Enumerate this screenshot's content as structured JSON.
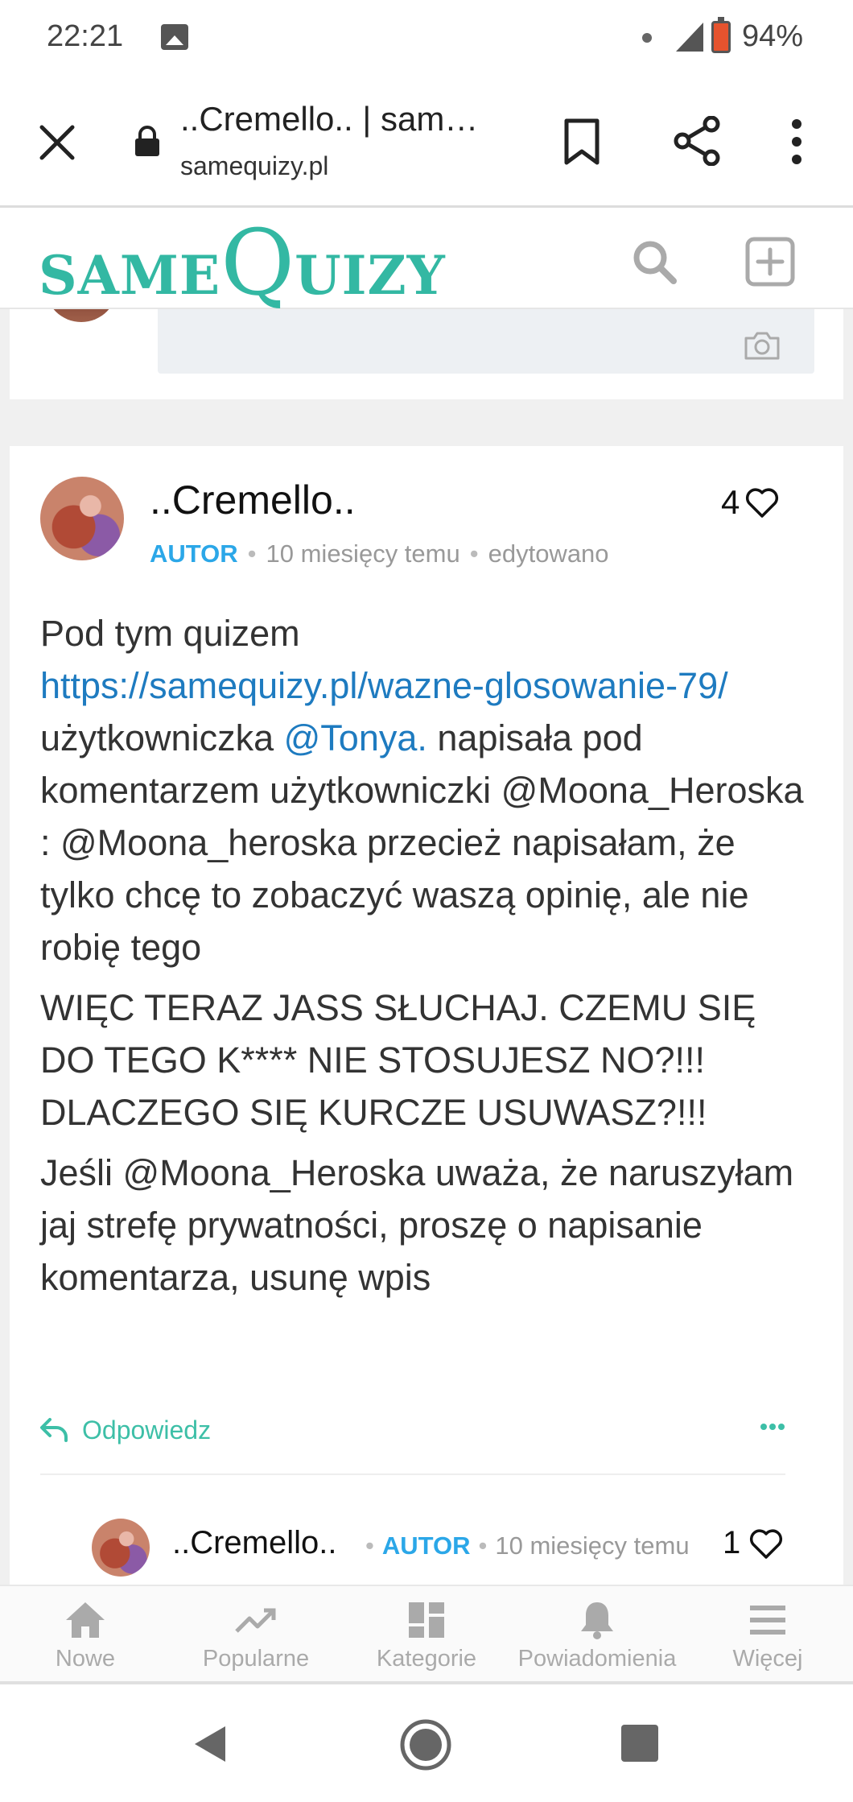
{
  "status_bar": {
    "time": "22:21",
    "battery_percent": "94%"
  },
  "browser": {
    "tab_title": "..Cremello.. | sam…",
    "url": "samequizy.pl"
  },
  "site": {
    "logo_part1": "SAME",
    "logo_q": "Q",
    "logo_part2": "UIZY",
    "brand_color": "#33b8a3"
  },
  "comment": {
    "author": "..Cremello..",
    "badge": "AUTOR",
    "time_ago": "10 miesięcy temu",
    "edited": "edytowano",
    "likes": "4",
    "paragraph1_before_link": "Pod tym quizem",
    "link": "https://samequizy.pl/wazne-glosowanie-79/",
    "paragraph1_before_mention": "użytkowniczka",
    "mention": "@Tonya.",
    "paragraph1_rest": "napisała pod komentarzem użytkowniczki @Moona_Heroska : @Moona_heroska przecież napisałam, że tylko chcę to zobaczyć waszą opinię, ale nie robię tego",
    "paragraph2": "WIĘC TERAZ JASS SŁUCHAJ. CZEMU SIĘ DO TEGO K**** NIE STOSUJESZ NO?!!! DLACZEGO SIĘ KURCZE USUWASZ?!!!",
    "paragraph3": "Jeśli @Moona_Heroska uważa, że naruszyłam jaj strefę prywatności, proszę o napisanie komentarza, usunę wpis",
    "reply_label": "Odpowiedz"
  },
  "sub_comment": {
    "author": "..Cremello..",
    "badge": "AUTOR",
    "time_ago": "10 miesięcy temu",
    "likes": "1"
  },
  "bottom_nav": {
    "items": [
      {
        "label": "Nowe",
        "icon": "home-icon"
      },
      {
        "label": "Popularne",
        "icon": "trending-icon"
      },
      {
        "label": "Kategorie",
        "icon": "grid-icon"
      },
      {
        "label": "Powiadomienia",
        "icon": "bell-icon"
      },
      {
        "label": "Więcej",
        "icon": "hamburger-icon"
      }
    ]
  }
}
